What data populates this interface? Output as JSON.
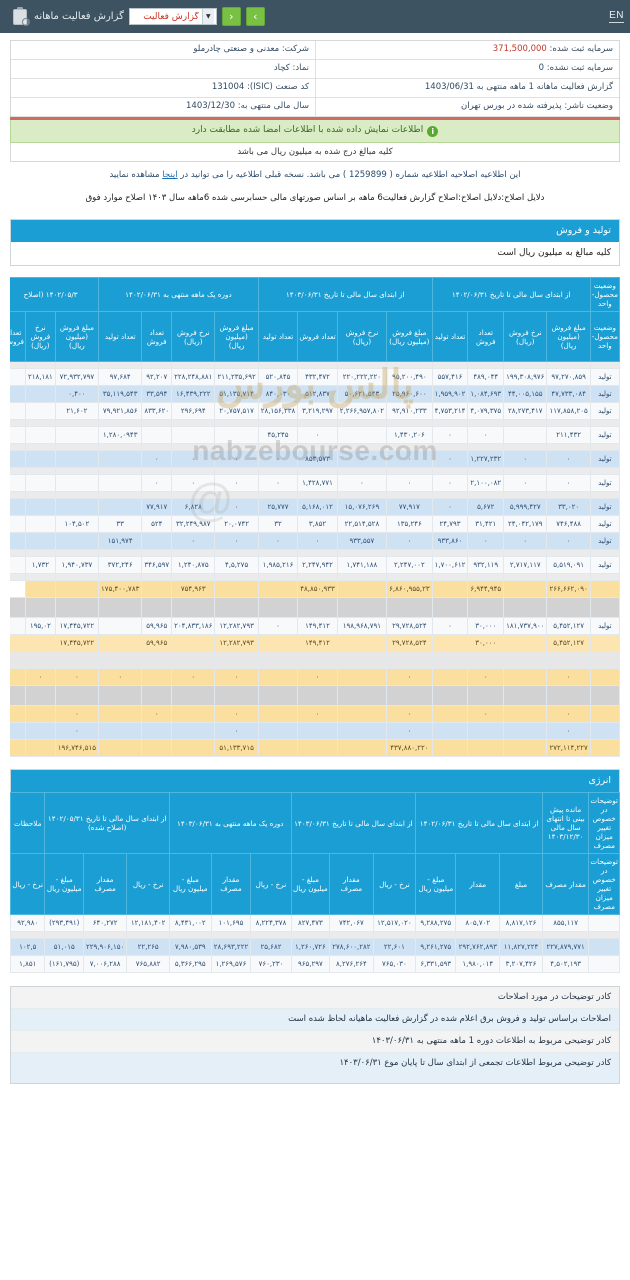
{
  "topbar": {
    "en_label": "EN",
    "report_title": "گزارش فعالیت ماهانه",
    "select_value": "گزارش فعالیت",
    "prev_label": "‹",
    "next_label": "›"
  },
  "company": {
    "name_label": "شرکت:",
    "name_value": "معدنی و صنعتی چادرملو",
    "capital_label": "سرمایه ثبت شده:",
    "capital_value": "371,500,000",
    "symbol_label": "نماد:",
    "symbol_value": "کچاد",
    "unreg_capital_label": "سرمایه ثبت نشده:",
    "unreg_capital_value": "0",
    "isic_label": "کد صنعت (ISIC):",
    "isic_value": "131004",
    "period_label": "گزارش فعالیت ماهانه  1 ماهه منتهی به",
    "period_value": "1403/06/31",
    "fiscal_label": "سال مالی منتهی به:",
    "fiscal_value": "1403/12/30",
    "publisher_label": "وضعیت ناشر:",
    "publisher_value": "پذیرفته شده در بورس تهران"
  },
  "banner": {
    "icon": "info-icon",
    "text": "اطلاعات نمایش داده شده با اطلاعات امضا شده مطابقت دارد"
  },
  "notes": {
    "unit_note": "کلیه مبالغ درج شده به میلیون ریال می باشد",
    "amend_note_prefix": "این اطلاعیه اصلاحیه اطلاعیه شماره (",
    "amend_number": "1259899",
    "amend_note_suffix": ") می باشد. نسخه قبلی اطلاعیه را می توانید در",
    "amend_link": "اینجا",
    "amend_note_end": "مشاهده نمایید",
    "reason_note": "دلایل اصلاح:دلایل اصلاح:اصلاح گزارش فعالیت6 ماهه بر اساس صورتهای مالی حسابرسی شده 6ماهه سال ۱۴۰۳ اصلاح موارد فوق"
  },
  "section_sales": {
    "title": "تولید و فروش",
    "subtitle": "کلیه مبالغ به میلیون ریال است"
  },
  "section_energy": {
    "title": "انرژی"
  },
  "watermark": {
    "site": "nabzebourse.com",
    "logo": "پالس بورس",
    "at": "@"
  },
  "sales_table": {
    "group_headers": [
      {
        "label": "وضعیت محصول-واحد",
        "span": 1
      },
      {
        "label": "از ابتدای سال مالی تا تاریخ ۱۴۰۲/۰۶/۳۱",
        "span": 4
      },
      {
        "label": "از ابتدای سال مالی تا تاریخ ۱۴۰۳/۰۶/۳۱",
        "span": 4
      },
      {
        "label": "دوره یک ماهه منتهی به ۱۴۰۲/۰۶/۳۱",
        "span": 4
      },
      {
        "label": "۱۴۰۲/۰۵/۳ (اصلاح",
        "span": 3
      }
    ],
    "columns": [
      "وضعیت محصول-واحد",
      "مبلغ فروش (میلیون ریال)",
      "نرخ فروش (ریال)",
      "تعداد فروش",
      "تعداد تولید",
      "مبلغ فروش (میلیون ریال)",
      "نرخ فروش (ریال)",
      "تعداد فروش",
      "تعداد تولید",
      "مبلغ فروش (میلیون ریال)",
      "نرخ فروش (ریال)",
      "تعداد فروش",
      "تعداد تولید",
      "مبلغ فروش (میلیون ریال)",
      "نرخ فروش (ریال)",
      "تعداد فروش"
    ],
    "rows": [
      {
        "style": "r-grey",
        "cells": [
          "",
          "",
          "",
          "",
          "",
          "",
          "",
          "",
          "",
          "",
          "",
          "",
          "",
          "",
          "",
          ""
        ]
      },
      {
        "style": "r-white",
        "cells": [
          "تولید",
          "۹۷,۲۷۰,۸۵۹",
          "۱۹۹,۳۰۸,۹۷۶",
          "۴۸۹,۰۴۴",
          "۵۵۷,۴۱۶",
          "۹۵,۲۰۰,۴۹۰",
          "۲۲۰,۲۲۲,۲۲۰",
          "۴۳۲,۴۷۲",
          "۵۲۰,۸۴۵",
          "۲۱۱,۲۳۵,۶۹۲",
          "۲۲۸,۲۴۸,۸۸۱",
          "۹۲,۲۰۷",
          "۹۷,۶۸۴",
          "۷۲,۹۳۲,۷۹۷",
          "۲۱۸,۱۸۱",
          ""
        ]
      },
      {
        "style": "r-blue",
        "cells": [
          "تولید",
          "۴۷,۷۳۳,۰۸۴",
          "۴۴,۰۰۵,۱۵۵",
          "۱,۰۸۴,۶۹۳",
          "۱,۹۵۹,۹۰۲",
          "۲۵,۹۶۰,۶۰۰",
          "۵۰,۶۲۱,۵۴۳",
          "۵۱۲,۸۳۷",
          "۸۴۰,۰۳۰",
          "۵۱,۱۳۵,۷۱۴",
          "۱۶,۴۳۹,۲۲۲",
          "۳۳,۵۹۴",
          "۳۵,۱۱۹,۵۴۳",
          "۰,۴۰۰",
          "",
          ""
        ]
      },
      {
        "style": "r-white",
        "cells": [
          "تولید",
          "۱۱۷,۸۵۸,۲۰۵",
          "۲۸,۲۷۳,۴۱۷",
          "۴,۰۷۹,۳۷۵",
          "۴,۷۵۳,۲۱۴",
          "۹۲,۹۱۰,۲۳۳",
          "۲,۲۶۶,۹۵۷,۸۰۲",
          "۳,۲۱۹,۲۹۷",
          "۲۸,۱۵۶,۳۳۸",
          "۲۰,۷۵۷,۵۱۷",
          "۲۹۶,۶۹۴",
          "۸۳۳,۶۲۰",
          "۷۹,۹۲۱,۸۵۶",
          "۲۱,۶۰۲",
          "",
          ""
        ]
      },
      {
        "style": "r-grey",
        "cells": [
          "",
          "",
          "",
          "",
          "",
          "",
          "",
          "",
          "",
          "",
          "",
          "",
          "",
          "",
          "",
          ""
        ]
      },
      {
        "style": "r-white",
        "cells": [
          "تولید",
          "۲۱۱,۴۳۲",
          "",
          "۰",
          "۰",
          "۱,۴۳۰,۲۰۶",
          "",
          "۰",
          "۴۵,۲۴۵",
          "",
          "",
          "",
          "۱,۲۸۰,۰۹۴۳",
          "",
          "",
          ""
        ]
      },
      {
        "style": "r-grey",
        "cells": [
          "",
          "",
          "",
          "",
          "",
          "",
          "",
          "",
          "",
          "",
          "",
          "",
          "",
          "",
          "",
          ""
        ]
      },
      {
        "style": "r-blue",
        "cells": [
          "تولید",
          "۰",
          "۰",
          "۱,۲۲۷,۲۳۲",
          "۰",
          "۰",
          "۰",
          "۸۵۳,۵۷۳",
          "۰",
          "۰",
          "۰",
          "۰",
          "",
          "",
          "",
          ""
        ]
      },
      {
        "style": "r-grey",
        "cells": [
          "",
          "",
          "",
          "",
          "",
          "",
          "",
          "",
          "",
          "",
          "",
          "",
          "",
          "",
          "",
          ""
        ]
      },
      {
        "style": "r-white",
        "cells": [
          "تولید",
          "۰",
          "۰",
          "۲,۱۰۰,۰۸۲",
          "۰",
          "۰",
          "۰",
          "۱,۴۲۸,۷۷۱",
          "۰",
          "۰",
          "۰",
          "۰",
          "",
          "",
          "",
          ""
        ]
      },
      {
        "style": "r-grey",
        "cells": [
          "",
          "",
          "",
          "",
          "",
          "",
          "",
          "",
          "",
          "",
          "",
          "",
          "",
          "",
          "",
          ""
        ]
      },
      {
        "style": "r-blue",
        "cells": [
          "تولید",
          "۳۳,۰۲۰",
          "۵,۹۹۹,۴۲۷",
          "۵,۶۷۲",
          "۰",
          "۷۷,۹۱۷",
          "۱۵,۰۷۶,۲۶۹",
          "۵,۱۶۸,۰۱۲",
          "۲۵,۷۷۷",
          "۰",
          "۶,۸۲۸",
          "۷۷,۹۱۷",
          "",
          "",
          "",
          ""
        ]
      },
      {
        "style": "r-white",
        "cells": [
          "تولید",
          "۷۴۶,۴۸۸",
          "۲۴,۰۴۲,۱۷۹",
          "۳۱,۴۲۱",
          "۲۴,۷۹۳",
          "۱۳۵,۲۴۶",
          "۲۲,۵۱۴,۵۲۸",
          "۳,۸۵۲",
          "۳۲",
          "۲۰,۰۷۴۲",
          "۳۲,۲۴۹,۹۸۷",
          "۵۲۴",
          "۳۳",
          "۱۰۴,۵۰۲",
          "",
          ""
        ]
      },
      {
        "style": "r-blue",
        "cells": [
          "تولید",
          "۰",
          "۰",
          "۰",
          "۹۳۳,۸۶۰",
          "۰",
          "۹۳۳,۵۵۷",
          "۰",
          "۰",
          "۰",
          "۰",
          "",
          "۱۵۱,۹۷۴",
          "",
          "",
          "",
          ""
        ]
      },
      {
        "style": "r-grey",
        "cells": [
          "",
          "",
          "",
          "",
          "",
          "",
          "",
          "",
          "",
          "",
          "",
          "",
          "",
          "",
          "",
          ""
        ]
      },
      {
        "style": "r-white",
        "cells": [
          "تولید",
          "۵,۵۱۹,۰۹۱",
          "۲,۷۱۷,۱۱۷",
          "۹۳۲,۱۱۹",
          "۱,۷۰۰,۶۱۲",
          "۲,۲۴۷,۰۰۲",
          "۱,۷۴۱,۱۸۸",
          "۲,۲۴۷,۹۴۲",
          "۱,۹۸۵,۲۱۶",
          "۴,۵,۲۷۵",
          "۱,۲۴۰,۸۷۵",
          "۳۴۶,۵۹۷",
          "۳۷۲,۲۴۶",
          "۱,۹۴۰,۷۳۷",
          "۱,۷۳۲",
          ""
        ]
      },
      {
        "style": "r-grey",
        "cells": [
          "",
          "",
          "",
          "",
          "",
          "",
          "",
          "",
          "",
          "",
          "",
          "",
          "",
          "",
          "",
          ""
        ]
      },
      {
        "style": "r-sum",
        "cells": [
          "",
          "۲۶۶,۶۶۲,۰۹۰",
          "",
          "۶,۹۴۴,۹۴۵",
          "",
          "۶,۸۶۰,۹۵۵,۲۳",
          "",
          "۴۸,۸۵۰,۹۳۳",
          "",
          "",
          "۷۵۴,۹۶۳",
          "",
          "۱۷۵,۴۰۰,۷۸۳",
          "",
          ""
        ]
      },
      {
        "style": "r-spacer",
        "cells": [
          "",
          "",
          "",
          "",
          "",
          "",
          "",
          "",
          "",
          "",
          "",
          "",
          "",
          "",
          "",
          ""
        ]
      },
      {
        "style": "r-white",
        "cells": [
          "تولید",
          "۵,۴۵۲,۱۲۷",
          "۱۸۱,۷۳۷,۹۰۰",
          "۳۰,۰۰۰",
          "۰",
          "۲۹,۷۲۸,۵۲۴",
          "۱۹۸,۹۶۸,۷۹۱",
          "۱۴۹,۴۱۲",
          "۰",
          "۱۲,۲۸۲,۷۹۳",
          "۲۰۴,۸۳۳,۱۸۶",
          "۵۹,۹۶۵",
          "",
          "۱۷,۴۴۵,۷۲۲",
          "۱۹۵,۰۲",
          ""
        ]
      },
      {
        "style": "r-sum2",
        "cells": [
          "",
          "۵,۴۵۲,۱۲۷",
          "",
          "۳۰,۰۰۰",
          "",
          "۲۹,۷۲۸,۵۲۴",
          "",
          "۱۴۹,۴۱۲",
          "",
          "۱۲,۲۸۲,۷۹۳",
          "",
          "۵۹,۹۶۵",
          "",
          "۱۷,۴۴۵,۷۲۲",
          "",
          ""
        ]
      },
      {
        "style": "r-spacer2",
        "cells": [
          "",
          "",
          "",
          "",
          "",
          "",
          "",
          "",
          "",
          "",
          "",
          "",
          "",
          "",
          "",
          ""
        ]
      },
      {
        "style": "r-sum",
        "cells": [
          "",
          "۰",
          "",
          "۰",
          "",
          "۰",
          "",
          "۰",
          "",
          "۰",
          "۰",
          "",
          "۰",
          "۰",
          "۰",
          ""
        ]
      },
      {
        "style": "r-spacer",
        "cells": [
          "",
          "",
          "",
          "",
          "",
          "",
          "",
          "",
          "",
          "",
          "",
          "",
          "",
          "",
          "",
          ""
        ]
      },
      {
        "style": "r-sum",
        "cells": [
          "",
          "۰",
          "",
          "۰",
          "",
          "۰",
          "",
          "۰",
          "",
          "۰",
          "",
          "۰",
          "",
          "۰",
          "",
          ""
        ]
      },
      {
        "style": "r-blank",
        "cells": [
          "",
          "۰",
          "",
          "",
          "",
          "۰",
          "",
          "",
          "",
          "۰",
          "",
          "",
          "",
          "۰",
          "",
          ""
        ]
      },
      {
        "style": "r-sum",
        "cells": [
          "",
          "۲۷۲,۱۱۴,۲۲۷",
          "",
          "",
          "",
          "۴۳۷,۸۸۰,۲۲۰",
          "",
          "",
          "",
          "۵۱,۱۳۳,۷۱۵",
          "",
          "",
          "",
          "۱۹۶,۷۴۶,۵۱۵",
          "",
          ""
        ]
      }
    ]
  },
  "energy_table": {
    "group_headers": [
      {
        "label": "توضیحات در خصوص تغییر میزان مصرف",
        "span": 1
      },
      {
        "label": "مانده پیش بینی تا انتهای سال مالی ۱۴۰۳/۱۲/۳۰",
        "span": 1
      },
      {
        "label": "از ابتدای سال مالی تا تاریخ ۱۴۰۲/۰۶/۳۱",
        "span": 3
      },
      {
        "label": "از ابتدای سال مالی تا تاریخ ۱۴۰۳/۰۶/۳۱",
        "span": 3
      },
      {
        "label": "دوره یک ماهه منتهی به ۱۴۰۳/۰۶/۳۱",
        "span": 3
      },
      {
        "label": "از ابتدای سال مالی تا تاریخ ۱۴۰۲/۰۵/۳۱ (اصلاح شده)",
        "span": 3
      },
      {
        "label": "ملاحظات",
        "span": 1
      }
    ],
    "columns": [
      "توضیحات در خصوص تغییر میزان مصرف",
      "مقدار مصرف",
      "مبلغ",
      "مقدار",
      "مبلغ - میلیون ریال",
      "نرخ - ریال",
      "مقدار مصرف",
      "مبلغ - میلیون ریال",
      "نرخ - ریال",
      "مقدار مصرف",
      "مبلغ - میلیون ریال",
      "نرخ - ریال",
      "مقدار مصرف",
      "مبلغ - میلیون ریال",
      "نرخ - ریال"
    ],
    "rows": [
      {
        "style": "r-white",
        "cells": [
          "",
          "۸۵۵,۱۱۷",
          "۸,۸۱۷,۱۲۶",
          "۸۰۵,۷۰۲",
          "۹,۲۸۸,۲۷۵",
          "۱۲,۵۱۷,۰۲۰",
          "۷۴۲,۰۶۷",
          "۸۲۷,۴۷۳",
          "۸,۲۲۴,۳۷۸",
          "۱۰۱,۶۹۵",
          "۸,۴۳۱,۰۰۲",
          "۱۲,۱۸۱,۴۰۲",
          "۶۴۰,۲۷۲",
          "(۲۹۳,۴۹۱)",
          "۹۲,۹۸۰"
        ]
      },
      {
        "style": "r-grey",
        "cells": [
          "",
          "",
          "",
          "",
          "",
          "",
          "",
          "",
          "",
          "",
          "",
          "",
          "",
          "",
          ""
        ]
      },
      {
        "style": "r-blue",
        "cells": [
          "",
          "۲۲۷,۸۷۹,۷۷۱",
          "۱۱,۸۲۷,۲۲۴",
          "۲۹۲,۷۶۲,۸۹۳",
          "۹,۲۶۱,۲۷۵",
          "۲۲,۶۰۱",
          "۲۷۸,۶۰۰,۲۸۲",
          "۱,۲۶۰,۷۲۶",
          "۲۵,۶۸۲",
          "۲۸,۶۹۳,۲۲۲",
          "۷,۹۸۰,۵۳۹",
          "۲۲,۲۶۵",
          "۲۲۹,۹۰۶,۱۵۰",
          "۵۱,۰۱۵",
          "۱۰۲,۵"
        ]
      },
      {
        "style": "r-white",
        "cells": [
          "",
          "۴,۵۰۲,۱۹۳",
          "۳,۲۰۷,۴۲۶",
          "۱,۹۸۰,۰۱۴",
          "۶,۳۳۱,۵۹۳",
          "۷۶۵,۰۳۰",
          "۸,۲۷۶,۲۶۴",
          "۹۶۵,۲۹۷",
          "۷۶۰,۲۳۰",
          "۱,۲۶۹,۵۷۶",
          "۵,۳۶۶,۲۹۵",
          "۷۶۵,۸۸۲",
          "۷,۰۰۶,۲۸۸",
          "(۱۶۱,۷۹۵)",
          "۱,۸۵۱"
        ]
      }
    ]
  },
  "footnotes": [
    {
      "text": "کادر توضیحات در مورد اصلاحات",
      "style": "plain"
    },
    {
      "text": "اصلاحات براساس تولید و فروش برق اعلام شده در گزارش فعالیت ماهیانه لحاظ شده است",
      "style": "alt"
    },
    {
      "text": "کادر توضیحی مربوط به اطلاعات دوره 1 ماهه منتهی به ۱۴۰۳/۰۶/۳۱",
      "style": "plain"
    },
    {
      "text": "کادر توضیحی مربوط اطلاعات تجمعی از ابتدای سال تا پایان موع ۱۴۰۳/۰۶/۳۱",
      "style": "alt"
    }
  ]
}
